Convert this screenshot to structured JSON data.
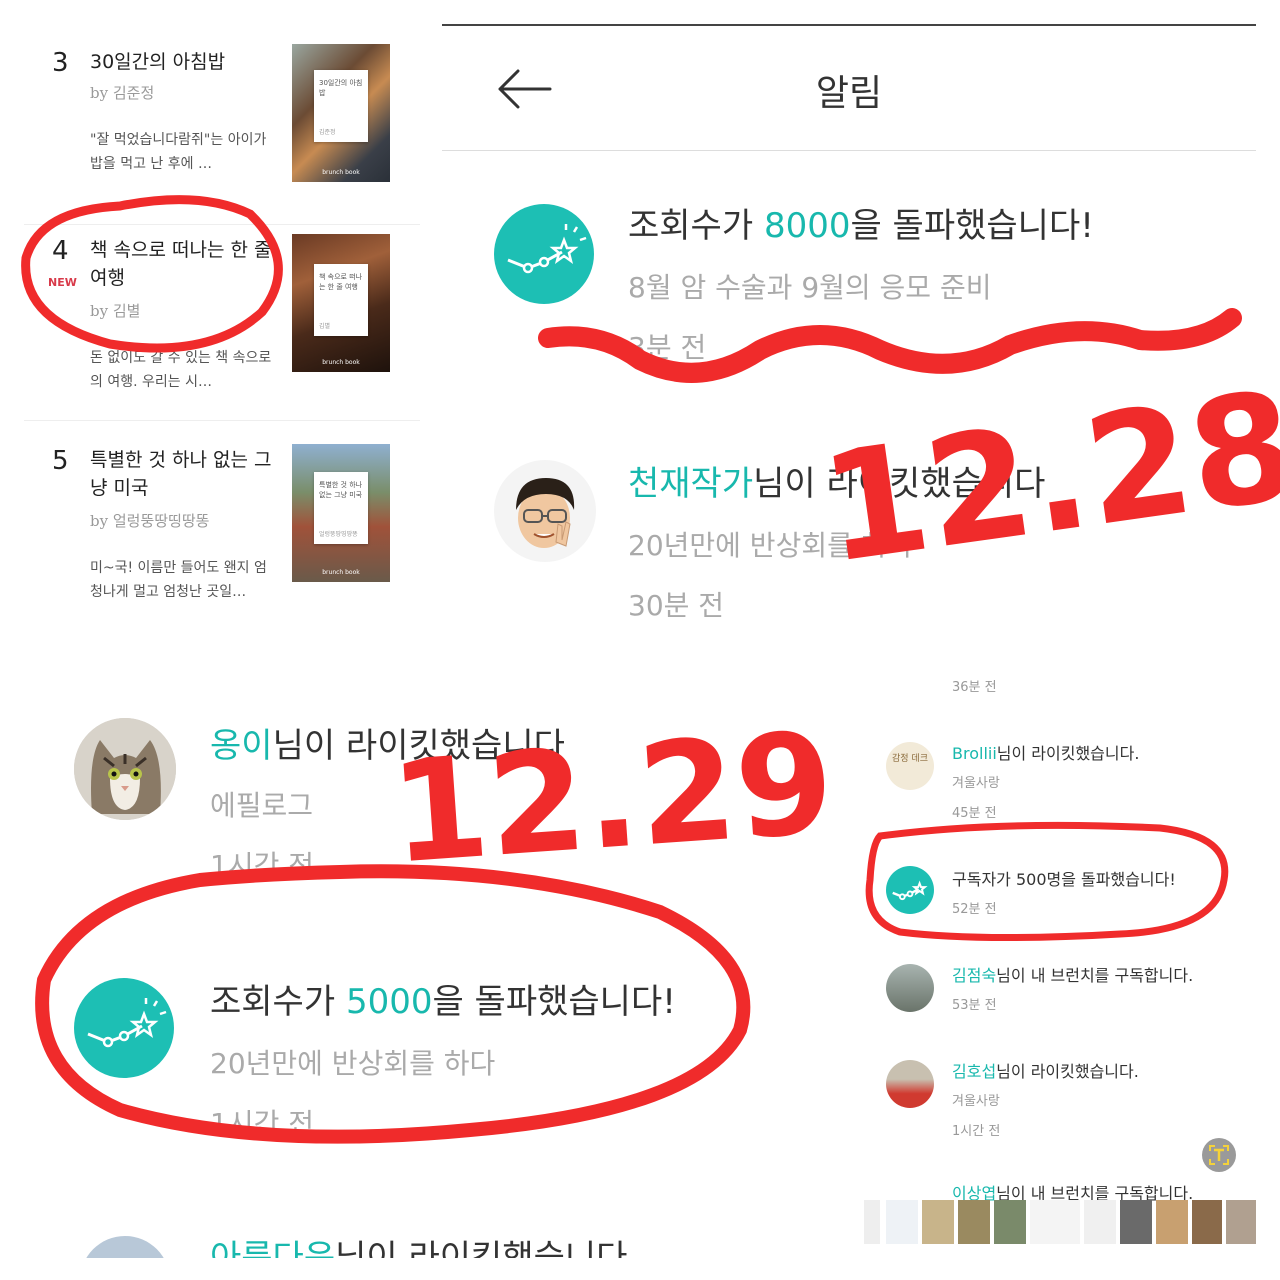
{
  "panel_rank": {
    "items": [
      {
        "rank": "3",
        "badge": "",
        "title": "30일간의 아침밥",
        "by": "by",
        "author": "김준정",
        "desc": "\"잘 먹었습니다람쥐\"는 아이가 밥을 먹고 난 후에 …",
        "cover_title": "30일간의 아침밥",
        "cover_author": "김준정",
        "cover_brand": "brunch book"
      },
      {
        "rank": "4",
        "badge": "NEW",
        "title": "책 속으로 떠나는 한 줄 여행",
        "by": "by",
        "author": "김별",
        "desc": "돈 없이도 갈 수 있는 책 속으로의 여행. 우리는 시…",
        "cover_title": "책 속으로 떠나는 한 줄 여행",
        "cover_author": "김별",
        "cover_brand": "brunch book"
      },
      {
        "rank": "5",
        "badge": "",
        "title": "특별한 것 하나 없는 그냥 미국",
        "by": "by",
        "author": "얼렁뚱땅띵땅똥",
        "desc": "미~국! 이름만 들어도 왠지 엄청나게 멀고 엄청난 곳일…",
        "cover_title": "특별한 것 하나 없는 그냥 미국",
        "cover_author": "얼렁뚱땅띵땅똥",
        "cover_brand": "brunch book"
      }
    ]
  },
  "panel_notice": {
    "header_title": "알림",
    "notifications": [
      {
        "pre": "조회수가 ",
        "highlight": "8000",
        "post": "을 돌파했습니다!",
        "subtitle": "8월 암 수술과 9월의 응모 준비",
        "time": "3분 전",
        "icon": "chart-star-icon"
      },
      {
        "pre": "",
        "highlight": "천재작가",
        "post": "님이 라이킷했습니다",
        "subtitle": "20년만에 반상회를 하다",
        "time": "30분 전",
        "icon": "avatar-memoji"
      }
    ]
  },
  "panel_notice2": {
    "notifications": [
      {
        "pre": "",
        "highlight": "옹이",
        "post": "님이 라이킷했습니다",
        "subtitle": "에필로그",
        "time": "1시간 전",
        "icon": "avatar-cat"
      },
      {
        "pre": "조회수가 ",
        "highlight": "5000",
        "post": "을 돌파했습니다!",
        "subtitle": "20년만에 반상회를 하다",
        "time": "1시간 전",
        "icon": "chart-star-icon"
      },
      {
        "pre": "",
        "highlight": "아름다운",
        "post": "님이 라이킷했습니다",
        "subtitle": "",
        "time": "",
        "icon": "avatar"
      }
    ]
  },
  "panel_small": {
    "top_time": "36분 전",
    "notifications": [
      {
        "highlight": "Brollii",
        "post": "님이 라이킷했습니다.",
        "pre": "",
        "subtitle": "겨울사랑",
        "time": "45분 전",
        "avatar_text": "감정 데크"
      },
      {
        "highlight": "",
        "post": "구독자가 500명을 돌파했습니다!",
        "pre": "",
        "subtitle": "",
        "time": "52분 전",
        "avatar_text": ""
      },
      {
        "highlight": "김점숙",
        "post": "님이 내 브런치를 구독합니다.",
        "pre": "",
        "subtitle": "",
        "time": "53분 전",
        "avatar_text": ""
      },
      {
        "highlight": "김호섭",
        "post": "님이 라이킷했습니다.",
        "pre": "",
        "subtitle": "겨울사랑",
        "time": "1시간 전",
        "avatar_text": ""
      },
      {
        "highlight": "이상엽",
        "post": "님이 내 브런치를 구독합니다.",
        "pre": "",
        "subtitle": "",
        "time": "",
        "avatar_text": ""
      }
    ]
  },
  "annotations": {
    "date_top": "12.28",
    "date_bottom": "12.29",
    "ink_color": "#f02b2b"
  },
  "colors": {
    "accent": "#1dbfb4",
    "ink": "#f02b2b",
    "new_badge": "#d83a4a"
  }
}
